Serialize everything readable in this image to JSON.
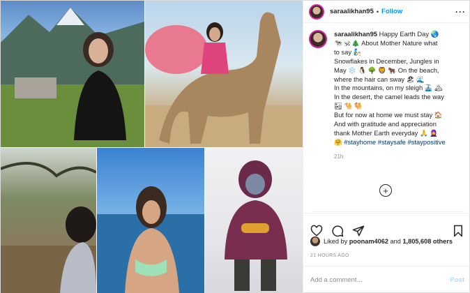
{
  "header": {
    "username": "saraalikhan95",
    "separator": "•",
    "follow_label": "Follow",
    "more_label": "···"
  },
  "caption": {
    "username": "saraalikhan95",
    "text": "Happy Earth Day 🌏\n🐄 🕉 🎄 About Mother Nature what\nto say 🧞\nSnowflakes in December, Jungles in\nMay ❄️ 🐧 🌳 🦁 🐂 On the beach,\nwhere the hair can sway 🏖 🌊\nIn the mountains, on my sleigh 🚠 🏔\nIn the desert, the camel leads the way\n🏜 🐪 🐫\nBut for now at home we must stay 🏠\nAnd with gratitude and appreciation\nthank Mother Earth everyday 🙏 🧕",
    "hashtags": "🤗 #stayhome #staysafe #staypositive",
    "time": "21h"
  },
  "more_comments_label": "+",
  "likes": {
    "prefix": "Liked by",
    "liker": "poonam4062",
    "connector": "and",
    "others": "1,805,608 others"
  },
  "post_age": "21 HOURS AGO",
  "comment": {
    "placeholder": "Add a comment...",
    "post_label": "Post"
  },
  "colors": {
    "link_blue": "#0095f6",
    "hashtag_blue": "#00376b",
    "story_ring": "#d6249f"
  },
  "icons": [
    "heart-icon",
    "comment-icon",
    "share-icon",
    "bookmark-icon",
    "plus-circle-icon"
  ]
}
